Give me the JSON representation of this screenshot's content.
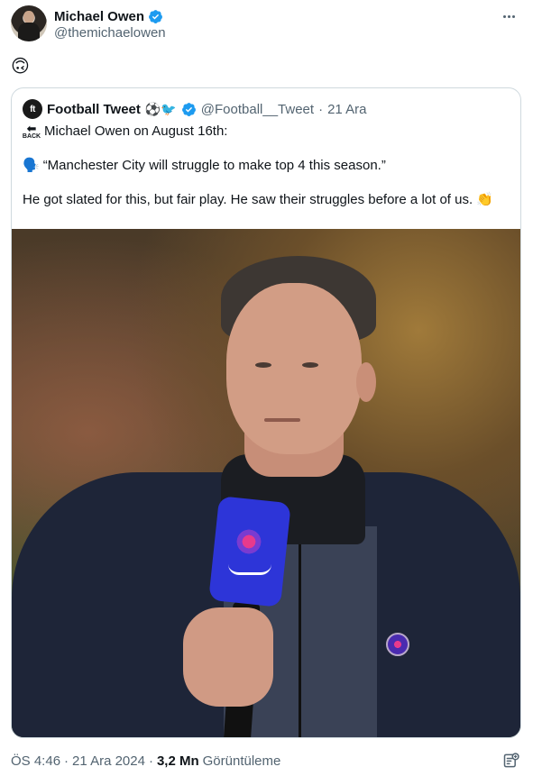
{
  "author": {
    "display_name": "Michael Owen",
    "handle": "@themichaelowen",
    "verified": true
  },
  "tweet": {
    "text": "🙃"
  },
  "quoted": {
    "avatar_text": "ft",
    "display_name": "Football Tweet",
    "name_emojis": "⚽🐦",
    "verified": true,
    "handle": "@Football__Tweet",
    "separator": "·",
    "date": "21 Ara",
    "back_label": "BACK",
    "line1": "Michael Owen on August 16th:",
    "line2_emoji": "🗣️",
    "line2": "“Manchester City will struggle to make top 4 this season.”",
    "line3": "He got slated for this, but fair play. He saw their struggles before a lot of us. 👏"
  },
  "footer": {
    "time": "ÖS 4:46",
    "separator": "·",
    "date": "21 Ara 2024",
    "separator2": "·",
    "views_count": "3,2 Mn",
    "views_label": "Görüntüleme"
  },
  "colors": {
    "verified_blue": "#1d9bf0",
    "secondary_text": "#536471",
    "border": "#cfd9de"
  },
  "icons": {
    "more": "more-horizontal-icon",
    "verified": "verified-badge-icon",
    "stats": "view-stats-icon",
    "back": "back-arrow-icon"
  }
}
